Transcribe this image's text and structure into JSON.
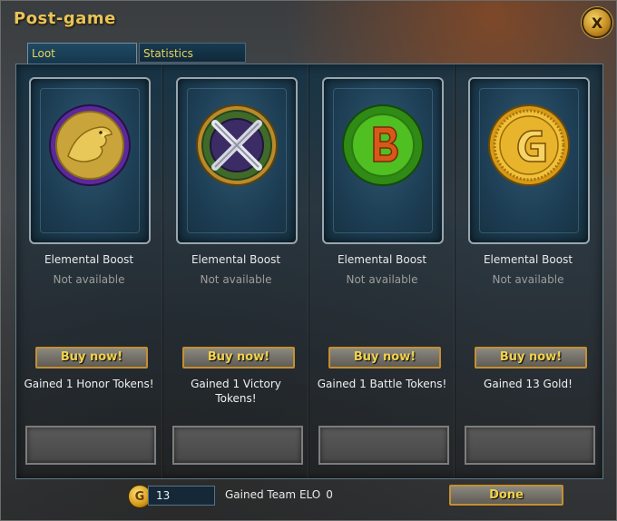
{
  "window": {
    "title": "Post-game",
    "close_label": "X"
  },
  "tabs": [
    {
      "label": "Loot",
      "active": true
    },
    {
      "label": "Statistics",
      "active": false
    }
  ],
  "loot": [
    {
      "icon": "honor-eagle-medal-icon",
      "name": "Elemental Boost",
      "status": "Not available",
      "buy_label": "Buy now!",
      "gain": "Gained 1 Honor Tokens!"
    },
    {
      "icon": "victory-crossed-swords-medal-icon",
      "name": "Elemental Boost",
      "status": "Not available",
      "buy_label": "Buy now!",
      "gain": "Gained 1 Victory Tokens!"
    },
    {
      "icon": "battle-token-b-medal-icon",
      "name": "Elemental Boost",
      "status": "Not available",
      "buy_label": "Buy now!",
      "gain": "Gained 1 Battle Tokens!"
    },
    {
      "icon": "gold-coin-g-medal-icon",
      "name": "Elemental Boost",
      "status": "Not available",
      "buy_label": "Buy now!",
      "gain": "Gained 13 Gold!"
    }
  ],
  "footer": {
    "coin_icon": "gold-coin-icon",
    "coin_letter": "G",
    "gold_amount": "13",
    "elo_label": "Gained Team ELO",
    "elo_value": "0",
    "done_label": "Done"
  },
  "colors": {
    "accent_gold": "#e9d35a",
    "button_border": "#c48f32",
    "panel_blue": "#1c3c52"
  }
}
